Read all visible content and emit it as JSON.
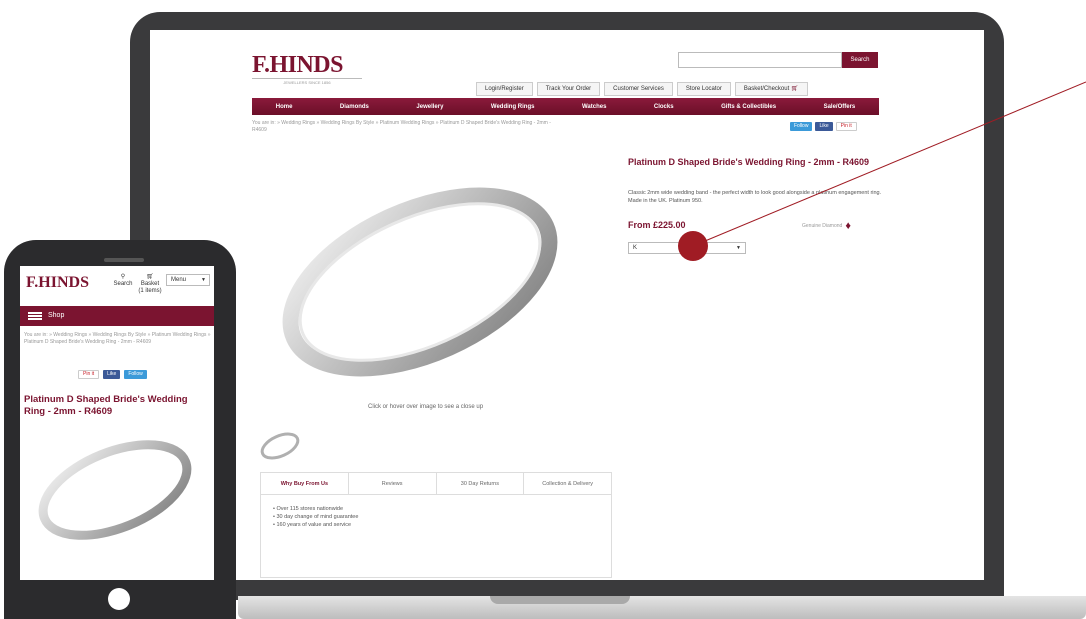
{
  "desktop": {
    "logo": "F.HINDS",
    "logo_sub": "JEWELLERS SINCE 1856",
    "search_button": "Search",
    "search_value": "",
    "top_links": [
      "Login/Register",
      "Track Your Order",
      "Customer Services",
      "Store Locator",
      "Basket/Checkout"
    ],
    "nav": [
      "Home",
      "Diamonds",
      "Jewellery",
      "Wedding Rings",
      "Watches",
      "Clocks",
      "Gifts & Collectibles",
      "Sale/Offers"
    ],
    "breadcrumb": "You are in:  »  Wedding Rings  »  Wedding Rings By Style  »  Platinum Wedding Rings  »  Platinum D Shaped Bride's Wedding Ring - 2mm - R4609",
    "social": {
      "twitter": "Follow",
      "facebook": "Like",
      "pinterest": "Pin it"
    },
    "product_title": "Platinum D Shaped Bride's Wedding Ring - 2mm - R4609",
    "product_desc": "Classic 2mm wide wedding band - the perfect width to look good alongside a platinum engagement ring. Made in the UK. Platinum 950.",
    "price": "From £225.00",
    "genuine_label": "Genuine Diamond",
    "size_select": "K",
    "image_hint": "Click or hover over image to see a close up",
    "tabs": [
      "Why Buy From Us",
      "Reviews",
      "30 Day Returns",
      "Collection & Delivery"
    ],
    "tab_bullets": [
      "Over 115 stores nationwide",
      "30 day change of mind guarantee",
      "160 years of value and service"
    ]
  },
  "mobile": {
    "logo": "F.HINDS",
    "search_label": "Search",
    "basket_label": "Basket",
    "basket_count": "(1 items)",
    "menu_label": "Menu",
    "shop_label": "Shop",
    "breadcrumb": "You are in:  »  Wedding Rings  »  Wedding Rings By Style  »  Platinum Wedding Rings  »  Platinum D Shaped Bride's Wedding Ring - 2mm - R4609",
    "social": {
      "pinterest": "Pin it",
      "facebook": "Like",
      "twitter": "Follow"
    },
    "product_title": "Platinum D Shaped Bride's Wedding Ring - 2mm - R4609"
  },
  "colors": {
    "brand": "#7b1430",
    "annotation": "#a01c24"
  }
}
